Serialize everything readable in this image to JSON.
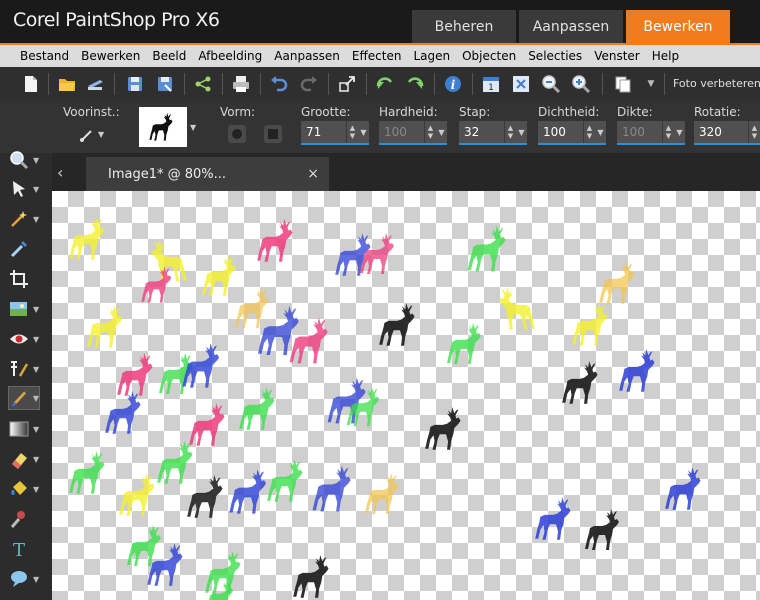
{
  "app": {
    "title": "Corel PaintShop Pro X6",
    "workspace_tabs": [
      "Beheren",
      "Aanpassen",
      "Bewerken"
    ],
    "active_tab": "Bewerken",
    "accent_color": "#f07c1e"
  },
  "menu": [
    "Bestand",
    "Bewerken",
    "Beeld",
    "Afbeelding",
    "Aanpassen",
    "Effecten",
    "Lagen",
    "Objecten",
    "Selecties",
    "Venster",
    "Help"
  ],
  "toolbar": {
    "icons": [
      "new-file-icon",
      "open-folder-icon",
      "scan-icon",
      "save-icon",
      "save-as-icon",
      "share-icon",
      "print-icon",
      "undo-icon",
      "redo-icon",
      "resize-icon",
      "rotate-left-icon",
      "rotate-right-icon",
      "info-icon",
      "calendar-icon",
      "fit-icon",
      "zoom-out-icon",
      "zoom-in-icon",
      "copy-icon"
    ],
    "photo_fix_label": "Foto verbeteren"
  },
  "options": {
    "preset_label": "Voorinst.:",
    "shape_label": "Vorm:",
    "size": {
      "label": "Grootte:",
      "value": "71"
    },
    "hardness": {
      "label": "Hardheid:",
      "value": "100"
    },
    "step": {
      "label": "Stap:",
      "value": "32"
    },
    "density": {
      "label": "Dichtheid:",
      "value": "100"
    },
    "thickness": {
      "label": "Dikte:",
      "value": "100"
    },
    "rotation": {
      "label": "Rotatie:",
      "value": "320"
    }
  },
  "tools": [
    "zoom-icon",
    "pick-icon",
    "selection-icon",
    "dropper-icon",
    "crop-icon",
    "object-extractor-icon",
    "red-eye-icon",
    "makeover-icon",
    "paint-brush-icon",
    "gradient-icon",
    "eraser-icon",
    "flood-fill-icon",
    "picture-tube-icon",
    "text-icon",
    "preset-shape-icon"
  ],
  "document": {
    "tab_label": "Image1* @  80%...",
    "close_label": "×",
    "back_label": "‹"
  },
  "stamp_colors": {
    "yellow": "#f3f02a",
    "orange": "#f2c550",
    "pink": "#ee3b7d",
    "green": "#3ce04b",
    "blue": "#2b3ed6",
    "black": "#222222"
  }
}
